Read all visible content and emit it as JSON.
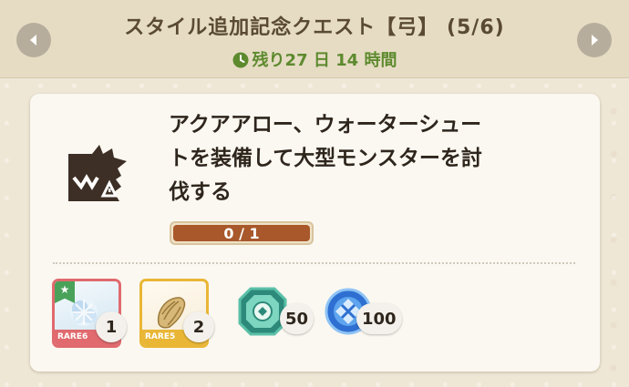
{
  "header": {
    "title": "スタイル追加記念クエスト【弓】 (5/6)",
    "remaining": "残り27 日 14 時間",
    "prev_icon": "chevron-left-icon",
    "next_icon": "chevron-right-icon",
    "accent_color": "#5d8a2e"
  },
  "quest": {
    "monster_icon": "large-monster-icon",
    "line1": "アクアアロー、ウォーターシュー",
    "line2": "トを装備して大型モンスターを討",
    "line3": "伐する",
    "progress_label": "0 / 1",
    "progress_value": 0,
    "progress_max": 1
  },
  "rewards": [
    {
      "icon": "ice-material-icon",
      "rarity": "RARE6",
      "count": "1",
      "color": "#e06a6e"
    },
    {
      "icon": "bone-material-icon",
      "rarity": "RARE5",
      "count": "2",
      "color": "#e9b636"
    },
    {
      "icon": "green-gem-icon",
      "count": "50"
    },
    {
      "icon": "blue-orb-icon",
      "count": "100"
    }
  ]
}
